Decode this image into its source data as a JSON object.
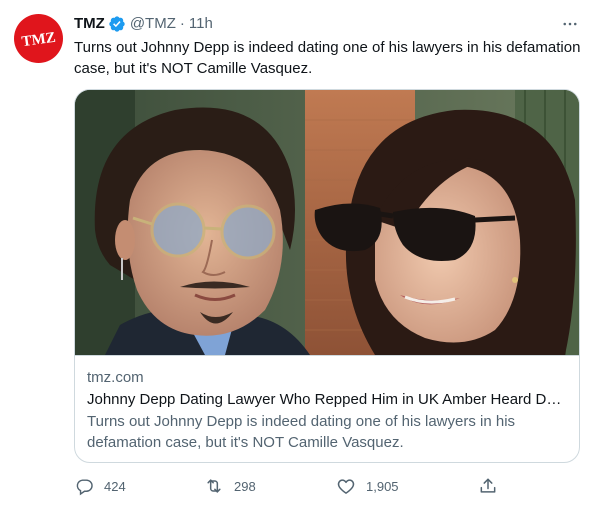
{
  "tweet": {
    "author_name": "TMZ",
    "avatar_text": "TMZ",
    "verified": true,
    "handle": "@TMZ",
    "separator": "·",
    "time": "11h",
    "text": "Turns out Johnny Depp is indeed dating one of his lawyers in his defamation case, but it's NOT Camille Vasquez."
  },
  "card": {
    "domain": "tmz.com",
    "title": "Johnny Depp Dating Lawyer Who Repped Him in UK Amber Heard Def...",
    "description": "Turns out Johnny Depp is indeed dating one of his lawyers in his defamation case, but it's NOT Camille Vasquez."
  },
  "actions": {
    "reply_count": "424",
    "retweet_count": "298",
    "like_count": "1,905"
  },
  "icons": {
    "more": "more-horizontal-icon",
    "verified": "verified-badge-icon",
    "reply": "reply-icon",
    "retweet": "retweet-icon",
    "like": "heart-icon",
    "share": "share-icon"
  },
  "colors": {
    "brand_red": "#e0151c",
    "verified_blue": "#1d9bf0",
    "secondary_text": "#536471",
    "border": "#cfd9de"
  }
}
